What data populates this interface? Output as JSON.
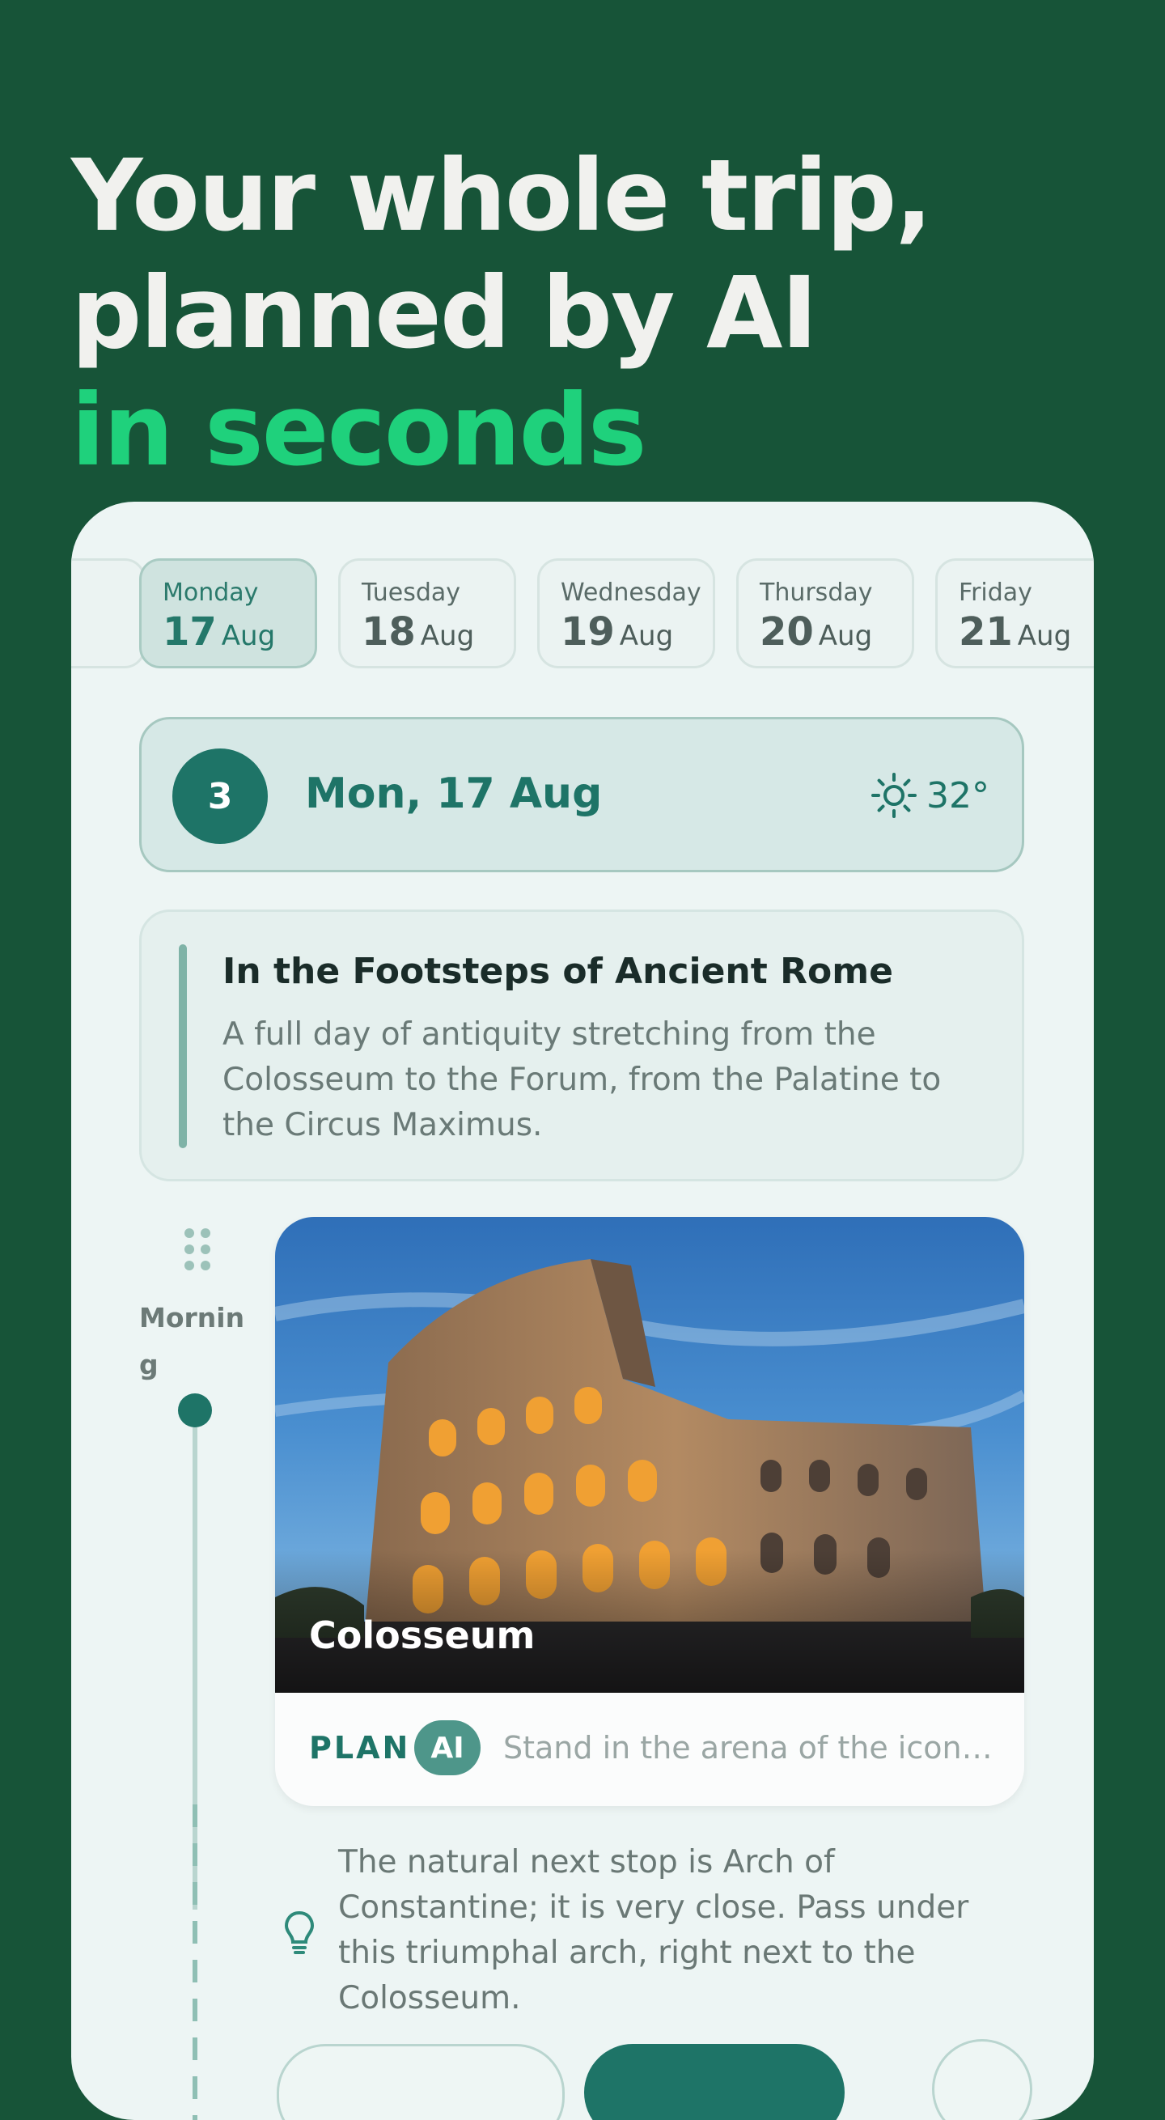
{
  "headline": {
    "line1": "Your whole trip,",
    "line2": "planned by AI",
    "accent": "in seconds"
  },
  "date_strip": [
    {
      "day": "Monday",
      "num": "17",
      "month": "Aug",
      "active": true
    },
    {
      "day": "Tuesday",
      "num": "18",
      "month": "Aug",
      "active": false
    },
    {
      "day": "Wednesday",
      "num": "19",
      "month": "Aug",
      "active": false
    },
    {
      "day": "Thursday",
      "num": "20",
      "month": "Aug",
      "active": false
    },
    {
      "day": "Friday",
      "num": "21",
      "month": "Aug",
      "active": false
    }
  ],
  "day_header": {
    "day_number": "3",
    "date": "Mon, 17 Aug",
    "weather_icon": "sun-icon",
    "temperature": "32°"
  },
  "theme": {
    "title": "In the Footsteps of Ancient Rome",
    "description": "A full day of antiquity stretching from the Colosseum to the Forum, from the Palatine to the Circus Maximus."
  },
  "timeline": {
    "slot_label": "Morning"
  },
  "place": {
    "name": "Colosseum",
    "plan_label": "PLAN",
    "ai_badge": "AI",
    "plan_text": "Stand in the arena of the iconic ..."
  },
  "tip": {
    "icon": "lightbulb-icon",
    "text": "The natural next stop is Arch of Constantine; it is very close. Pass under this triumphal arch, right next to the Colosseum."
  },
  "colors": {
    "background": "#175438",
    "accent": "#1fd17c",
    "primary": "#1e7467"
  }
}
